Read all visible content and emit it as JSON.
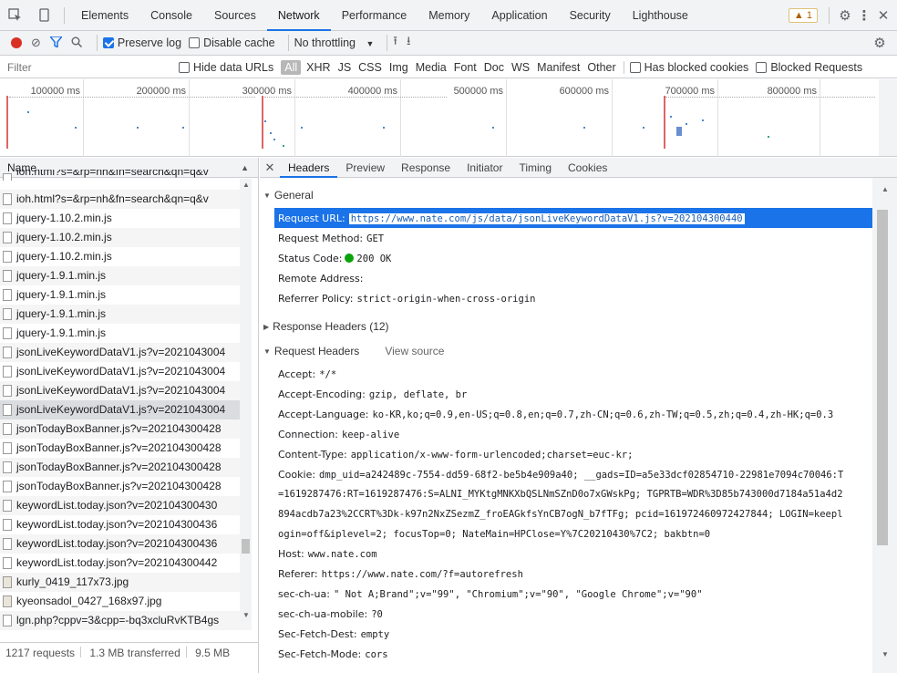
{
  "main_tabs": [
    "Elements",
    "Console",
    "Sources",
    "Network",
    "Performance",
    "Memory",
    "Application",
    "Security",
    "Lighthouse"
  ],
  "active_main_tab": "Network",
  "warning_count": "1",
  "toolbar": {
    "preserve_log": "Preserve log",
    "disable_cache": "Disable cache",
    "throttling": "No throttling"
  },
  "filter": {
    "placeholder": "Filter",
    "hide_data_urls": "Hide data URLs",
    "types": [
      "All",
      "XHR",
      "JS",
      "CSS",
      "Img",
      "Media",
      "Font",
      "Doc",
      "WS",
      "Manifest",
      "Other"
    ],
    "has_blocked_cookies": "Has blocked cookies",
    "blocked_requests": "Blocked Requests"
  },
  "overview": {
    "ticks": [
      "100000 ms",
      "200000 ms",
      "300000 ms",
      "400000 ms",
      "500000 ms",
      "600000 ms",
      "700000 ms",
      "800000 ms"
    ]
  },
  "list": {
    "header": "Name",
    "rows": [
      {
        "name": "ioh.html?s=&rp=nh&fn=search&qn=q&v",
        "icon": "doc"
      },
      {
        "name": "ioh.html?s=&rp=nh&fn=search&qn=q&v",
        "icon": "doc"
      },
      {
        "name": "jquery-1.10.2.min.js",
        "icon": "doc"
      },
      {
        "name": "jquery-1.10.2.min.js",
        "icon": "doc"
      },
      {
        "name": "jquery-1.10.2.min.js",
        "icon": "doc"
      },
      {
        "name": "jquery-1.9.1.min.js",
        "icon": "doc"
      },
      {
        "name": "jquery-1.9.1.min.js",
        "icon": "doc"
      },
      {
        "name": "jquery-1.9.1.min.js",
        "icon": "doc"
      },
      {
        "name": "jquery-1.9.1.min.js",
        "icon": "doc"
      },
      {
        "name": "jsonLiveKeywordDataV1.js?v=2021043004",
        "icon": "doc"
      },
      {
        "name": "jsonLiveKeywordDataV1.js?v=2021043004",
        "icon": "doc"
      },
      {
        "name": "jsonLiveKeywordDataV1.js?v=2021043004",
        "icon": "doc"
      },
      {
        "name": "jsonLiveKeywordDataV1.js?v=2021043004",
        "icon": "doc",
        "selected": true
      },
      {
        "name": "jsonTodayBoxBanner.js?v=202104300428",
        "icon": "doc"
      },
      {
        "name": "jsonTodayBoxBanner.js?v=202104300428",
        "icon": "doc"
      },
      {
        "name": "jsonTodayBoxBanner.js?v=202104300428",
        "icon": "doc"
      },
      {
        "name": "jsonTodayBoxBanner.js?v=202104300428",
        "icon": "doc"
      },
      {
        "name": "keywordList.today.json?v=202104300430",
        "icon": "doc"
      },
      {
        "name": "keywordList.today.json?v=202104300436",
        "icon": "doc"
      },
      {
        "name": "keywordList.today.json?v=202104300436",
        "icon": "doc"
      },
      {
        "name": "keywordList.today.json?v=202104300442",
        "icon": "doc"
      },
      {
        "name": "kurly_0419_117x73.jpg",
        "icon": "img"
      },
      {
        "name": "kyeonsadol_0427_168x97.jpg",
        "icon": "img"
      },
      {
        "name": "lgn.php?cppv=3&cpp=-bq3xcluRvKTB4gs",
        "icon": "doc"
      }
    ]
  },
  "status": {
    "requests": "1217 requests",
    "transferred": "1.3 MB transferred",
    "resources": "9.5 MB"
  },
  "detail_tabs": [
    "Headers",
    "Preview",
    "Response",
    "Initiator",
    "Timing",
    "Cookies"
  ],
  "active_detail_tab": "Headers",
  "general": {
    "title": "General",
    "request_url_key": "Request URL:",
    "request_url": "https://www.nate.com/js/data/jsonLiveKeywordDataV1.js?v=202104300440",
    "method_key": "Request Method:",
    "method": "GET",
    "status_key": "Status Code:",
    "status": "200 OK",
    "remote_key": "Remote Address:",
    "remote": "",
    "referrer_key": "Referrer Policy:",
    "referrer": "strict-origin-when-cross-origin"
  },
  "response_headers_title": "Response Headers (12)",
  "request_headers_title": "Request Headers",
  "view_source": "View source",
  "request_headers": [
    {
      "k": "Accept:",
      "v": "*/*"
    },
    {
      "k": "Accept-Encoding:",
      "v": "gzip, deflate, br"
    },
    {
      "k": "Accept-Language:",
      "v": "ko-KR,ko;q=0.9,en-US;q=0.8,en;q=0.7,zh-CN;q=0.6,zh-TW;q=0.5,zh;q=0.4,zh-HK;q=0.3"
    },
    {
      "k": "Connection:",
      "v": "keep-alive"
    },
    {
      "k": "Content-Type:",
      "v": "application/x-www-form-urlencoded;charset=euc-kr;"
    },
    {
      "k": "Cookie:",
      "v": "dmp_uid=a242489c-7554-dd59-68f2-be5b4e909a40; __gads=ID=a5e33dcf02854710-22981e7094c70046:T"
    },
    {
      "k": "",
      "v": "=1619287476:RT=1619287476:S=ALNI_MYKtgMNKXbQSLNmSZnD0o7xGWskPg; TGPRTB=WDR%3D85b743000d7184a51a4d2"
    },
    {
      "k": "",
      "v": "894acdb7a23%2CCRT%3Dk-k97n2NxZSezmZ_froEAGkfsYnCB7ogN_b7fTFg; pcid=161972460972427844; LOGIN=keepl"
    },
    {
      "k": "",
      "v": "ogin=off&iplevel=2; focusTop=0; NateMain=HPClose=Y%7C20210430%7C2; bakbtn=0"
    },
    {
      "k": "Host:",
      "v": "www.nate.com"
    },
    {
      "k": "Referer:",
      "v": "https://www.nate.com/?f=autorefresh"
    },
    {
      "k": "sec-ch-ua:",
      "v": "\" Not A;Brand\";v=\"99\", \"Chromium\";v=\"90\", \"Google Chrome\";v=\"90\""
    },
    {
      "k": "sec-ch-ua-mobile:",
      "v": "?0"
    },
    {
      "k": "Sec-Fetch-Dest:",
      "v": "empty"
    },
    {
      "k": "Sec-Fetch-Mode:",
      "v": "cors"
    }
  ],
  "colors": {
    "accent": "#1a73e8",
    "record": "#d93025",
    "status_ok": "#0ca20c"
  }
}
